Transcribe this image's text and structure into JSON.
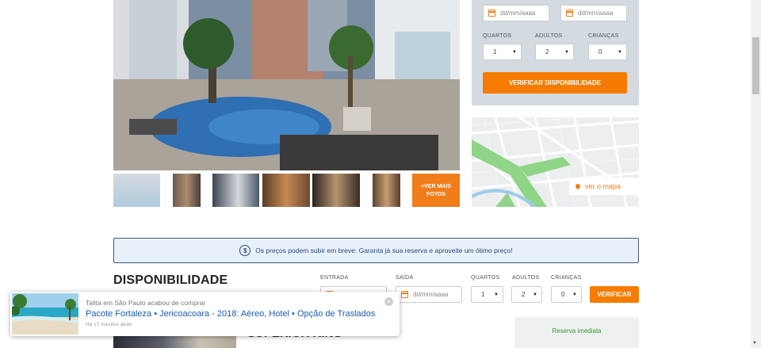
{
  "booking": {
    "checkin_placeholder": "dd/mm/aaaa",
    "checkout_placeholder": "dd/mm/aaaa",
    "rooms_label": "QUARTOS",
    "adults_label": "ADULTOS",
    "children_label": "CRIANÇAS",
    "rooms_value": "1",
    "adults_value": "2",
    "children_value": "0",
    "check_button": "VERIFICAR DISPONIBILIDADE"
  },
  "gallery": {
    "more_photos": "+VER MAIS FOTOS"
  },
  "map": {
    "link": "ver o mapa"
  },
  "notice": {
    "text": "Os preços podem subir em breve: Garanta já sua reserva e aproveite um ótimo preço!",
    "icon": "dollar-tag-icon"
  },
  "availability": {
    "title": "DISPONIBILIDADE",
    "checkin_label": "ENTRADA",
    "checkout_label": "SAÍDA",
    "checkout_placeholder": "dd/mm/aaaa",
    "rooms_label": "QUARTOS",
    "adults_label": "ADULTOS",
    "children_label": "CRIANÇAS",
    "rooms_value": "1",
    "adults_value": "2",
    "children_value": "0",
    "verify_button": "VERIFICAR"
  },
  "room": {
    "title": "SUPERIOR KING",
    "reserve_label": "Reserva imediata"
  },
  "toast": {
    "subtitle": "Talita em São Paulo acabou de comprar",
    "title": "Pacote Fortaleza • Jericoacoara - 2018: Aéreo, Hotel • Opção de Traslados",
    "time": "Há 17 minutos atrás"
  },
  "colors": {
    "accent": "#f57c00",
    "notice_border": "#3e5a86",
    "link_blue": "#1a5cab",
    "green": "#3a9a2e"
  }
}
